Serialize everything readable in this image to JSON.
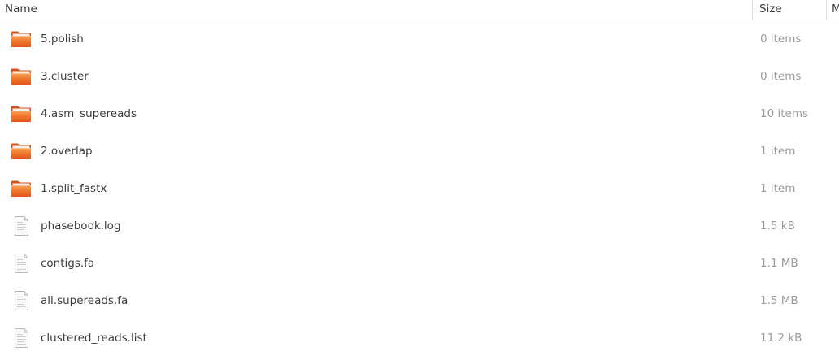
{
  "columns": {
    "name": "Name",
    "size": "Size",
    "modified": "M"
  },
  "files": [
    {
      "name": "5.polish",
      "size": "0 items",
      "icon": "folder-icon"
    },
    {
      "name": "3.cluster",
      "size": "0 items",
      "icon": "folder-icon"
    },
    {
      "name": "4.asm_supereads",
      "size": "10 items",
      "icon": "folder-icon"
    },
    {
      "name": "2.overlap",
      "size": "1 item",
      "icon": "folder-icon"
    },
    {
      "name": "1.split_fastx",
      "size": "1 item",
      "icon": "folder-icon"
    },
    {
      "name": "phasebook.log",
      "size": "1.5 kB",
      "icon": "text-file-icon"
    },
    {
      "name": "contigs.fa",
      "size": "1.1 MB",
      "icon": "text-file-icon"
    },
    {
      "name": "all.supereads.fa",
      "size": "1.5 MB",
      "icon": "text-file-icon"
    },
    {
      "name": "clustered_reads.list",
      "size": "11.2 kB",
      "icon": "text-file-icon"
    }
  ]
}
